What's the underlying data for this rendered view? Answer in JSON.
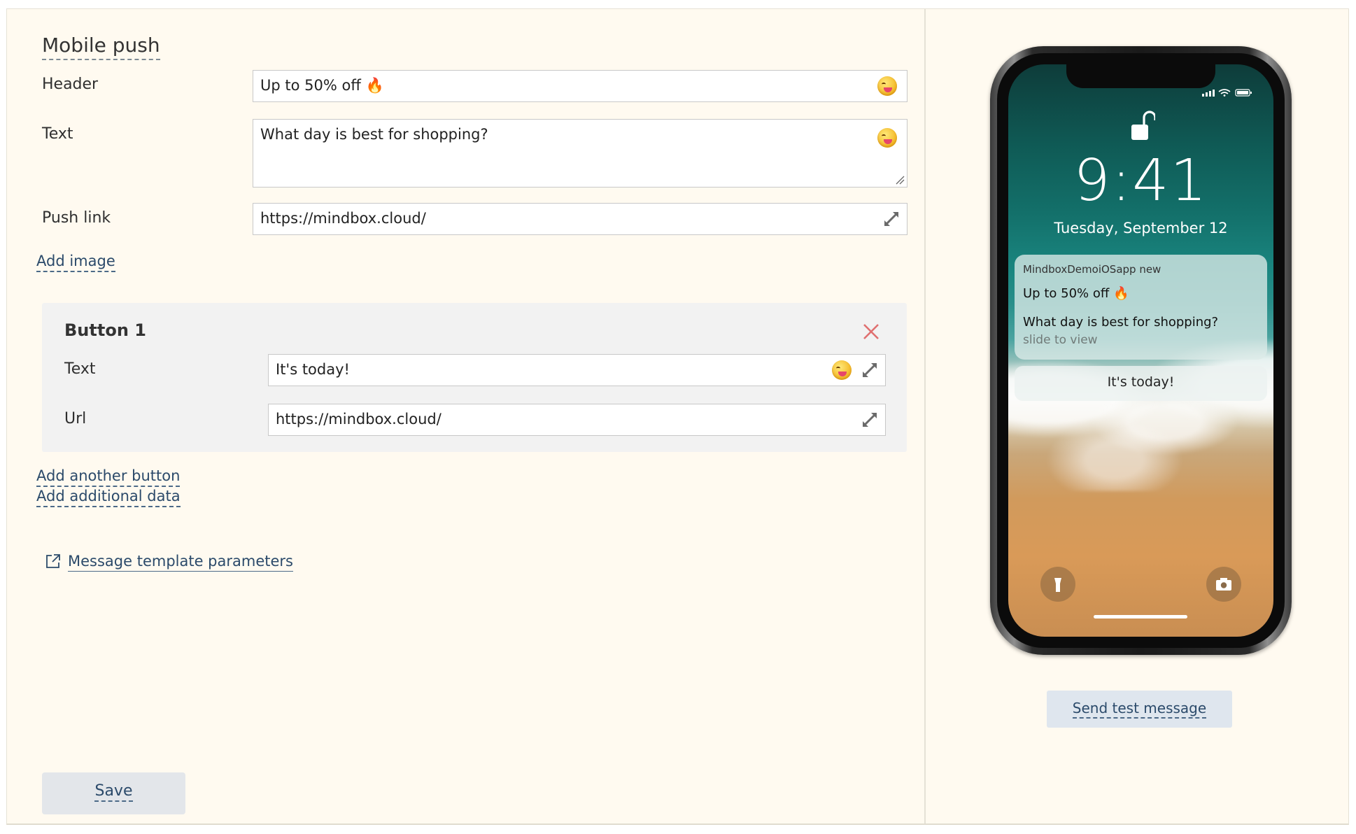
{
  "section_title": "Mobile push",
  "form": {
    "header_label": "Header",
    "header_value": "Up to 50% off 🔥",
    "text_label": "Text",
    "text_value": "What day is best for shopping?",
    "push_link_label": "Push link",
    "push_link_value": "https://mindbox.cloud/",
    "add_image": "Add image"
  },
  "button1": {
    "title": "Button 1",
    "text_label": "Text",
    "text_value": "It's today!",
    "url_label": "Url",
    "url_value": "https://mindbox.cloud/"
  },
  "links": {
    "add_another_button": "Add another button",
    "add_additional_data": "Add additional data",
    "template_params": "Message template parameters"
  },
  "save_label": "Save",
  "preview": {
    "time": "9:41",
    "date": "Tuesday, September 12",
    "app_name": "MindboxDemoiOSapp new",
    "notif_header": "Up to 50% off 🔥",
    "notif_text": "What day is best for shopping?",
    "notif_hint": "slide to view",
    "button_text": "It's today!"
  },
  "send_test_label": "Send test message",
  "icons": [
    "emoji-icon",
    "expand-icon",
    "close-icon",
    "external-link-icon",
    "lock-icon",
    "flashlight-icon",
    "camera-icon"
  ],
  "colors": {
    "background": "#fffaf0",
    "link": "#2b4a6a",
    "close": "#e07070"
  }
}
